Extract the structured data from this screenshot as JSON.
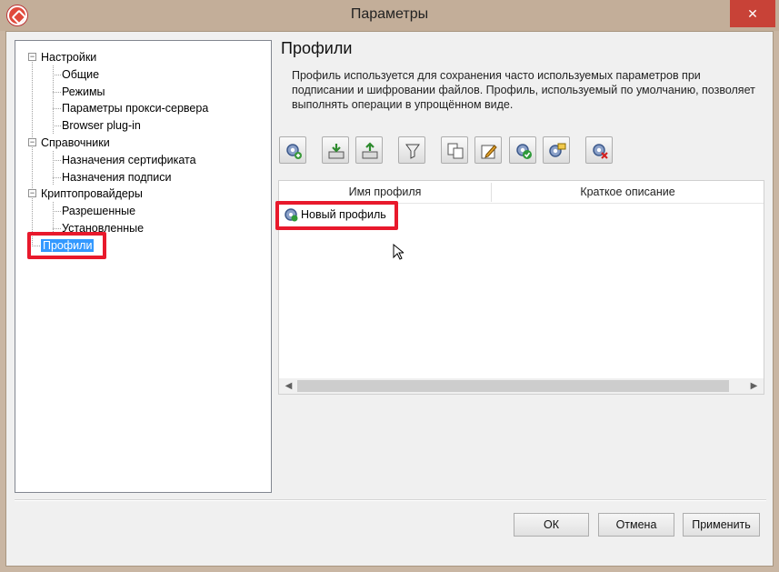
{
  "window": {
    "title": "Параметры",
    "close_glyph": "✕"
  },
  "tree": {
    "nodes": [
      {
        "label": "Настройки",
        "expander": "−",
        "children": [
          "Общие",
          "Режимы",
          "Параметры прокси-сервера",
          "Browser plug-in"
        ]
      },
      {
        "label": "Справочники",
        "expander": "−",
        "children": [
          "Назначения сертификата",
          "Назначения подписи"
        ]
      },
      {
        "label": "Криптопровайдеры",
        "expander": "−",
        "children": [
          "Разрешенные",
          "Установленные"
        ]
      }
    ],
    "selected": "Профили"
  },
  "content": {
    "title": "Профили",
    "description": "Профиль используется для сохранения часто используемых параметров при подписании и шифровании файлов. Профиль, используемый по умолчанию, позволяет выполнять операции в упрощённом виде."
  },
  "toolbar": {
    "buttons": [
      "create-profile-icon",
      "import-profile-icon",
      "export-profile-icon",
      "filter-icon",
      "copy-profile-icon",
      "edit-profile-icon",
      "set-default-icon",
      "profile-properties-icon",
      "delete-profile-icon"
    ]
  },
  "grid": {
    "columns": [
      "Имя профиля",
      "Краткое описание"
    ],
    "rows": [
      {
        "name": "Новый профиль",
        "description": ""
      }
    ]
  },
  "buttons": {
    "ok": "ОК",
    "cancel": "Отмена",
    "apply": "Применить"
  },
  "colors": {
    "highlight": "#e8192c",
    "selection": "#3399ff"
  }
}
